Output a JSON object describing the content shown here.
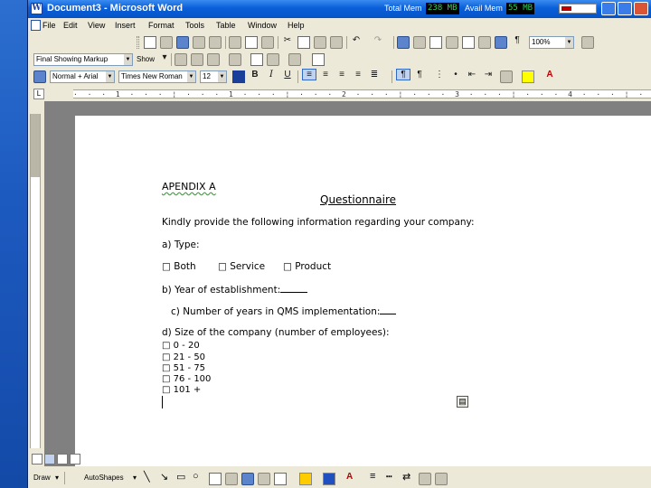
{
  "window": {
    "title": "Document3 - Microsoft Word",
    "total_mem_label": "Total Mem",
    "total_mem_value": "238 MB",
    "avail_mem_label": "Avail Mem",
    "avail_mem_value": "55 MB",
    "mem_meter_fraction": 0.3
  },
  "menu": {
    "items": [
      "File",
      "Edit",
      "View",
      "Insert",
      "Format",
      "Tools",
      "Table",
      "Window",
      "Help"
    ]
  },
  "toolbar": {
    "zoom": "100%",
    "review_display": "Final Showing Markup",
    "show_label": "Show",
    "style": "Normal + Arial",
    "font": "Times New Roman",
    "size": "12"
  },
  "ruler": {
    "text": "· · · 1 · · · ¦ · · · 1 · · · ¦ · · · 2 · · · ¦ · · · 3 · · · ¦ · · · 4 · · · ¦ · · · 5 · · · ¦ · · · 6 ·",
    "corner": "L"
  },
  "document": {
    "appendix": "APENDIX  A",
    "title": "Questionnaire",
    "intro": "Kindly provide the following information regarding your company:",
    "q_type": "a) Type:",
    "opt_both": "□ Both",
    "opt_service": "□ Service",
    "opt_product": "□ Product",
    "q_year": "b) Year of establishment:",
    "q_qms": "c) Number of years in QMS implementation:",
    "q_size": "d) Size of the company (number of employees):",
    "size_options": [
      "□ 0 - 20",
      "□ 21 - 50",
      "□ 51 - 75",
      "□ 76 - 100",
      "□ 101 +"
    ]
  },
  "drawbar": {
    "draw_label": "Draw",
    "autoshapes_label": "AutoShapes"
  }
}
